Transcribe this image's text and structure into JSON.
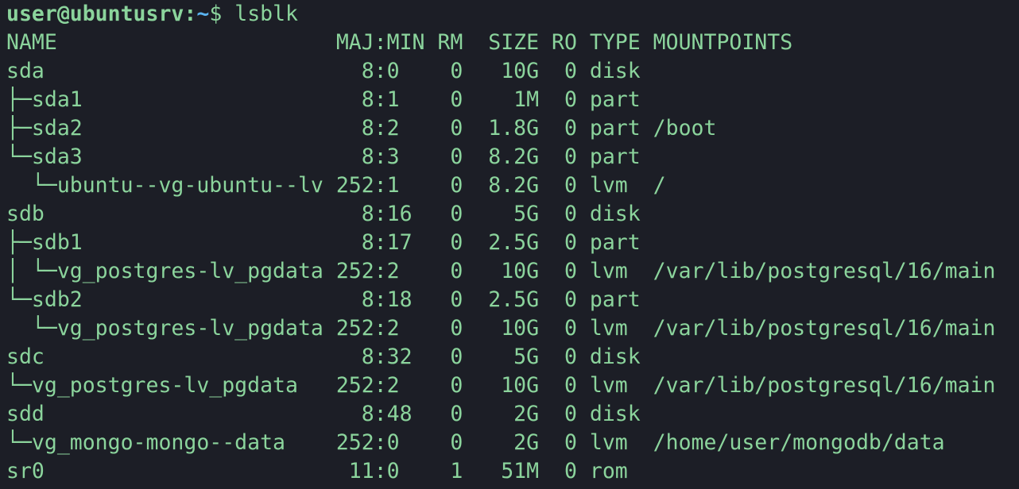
{
  "prompt": {
    "user_host": "user@ubuntusrv",
    "separator": ":",
    "path": "~",
    "symbol": "$ ",
    "command": "lsblk"
  },
  "output_lines": [
    "NAME                      MAJ:MIN RM  SIZE RO TYPE MOUNTPOINTS",
    "sda                         8:0    0   10G  0 disk ",
    "├─sda1                      8:1    0    1M  0 part ",
    "├─sda2                      8:2    0  1.8G  0 part /boot",
    "└─sda3                      8:3    0  8.2G  0 part ",
    "  └─ubuntu--vg-ubuntu--lv 252:1    0  8.2G  0 lvm  /",
    "sdb                         8:16   0    5G  0 disk ",
    "├─sdb1                      8:17   0  2.5G  0 part ",
    "│ └─vg_postgres-lv_pgdata 252:2    0   10G  0 lvm  /var/lib/postgresql/16/main",
    "└─sdb2                      8:18   0  2.5G  0 part ",
    "  └─vg_postgres-lv_pgdata 252:2    0   10G  0 lvm  /var/lib/postgresql/16/main",
    "sdc                         8:32   0    5G  0 disk ",
    "└─vg_postgres-lv_pgdata   252:2    0   10G  0 lvm  /var/lib/postgresql/16/main",
    "sdd                         8:48   0    2G  0 disk ",
    "└─vg_mongo-mongo--data    252:0    0    2G  0 lvm  /home/user/mongodb/data",
    "sr0                        11:0    1   51M  0 rom  "
  ],
  "colors": {
    "background": "#1c1e26",
    "text_green": "#8bd49c",
    "path_blue": "#5ab3f0"
  }
}
